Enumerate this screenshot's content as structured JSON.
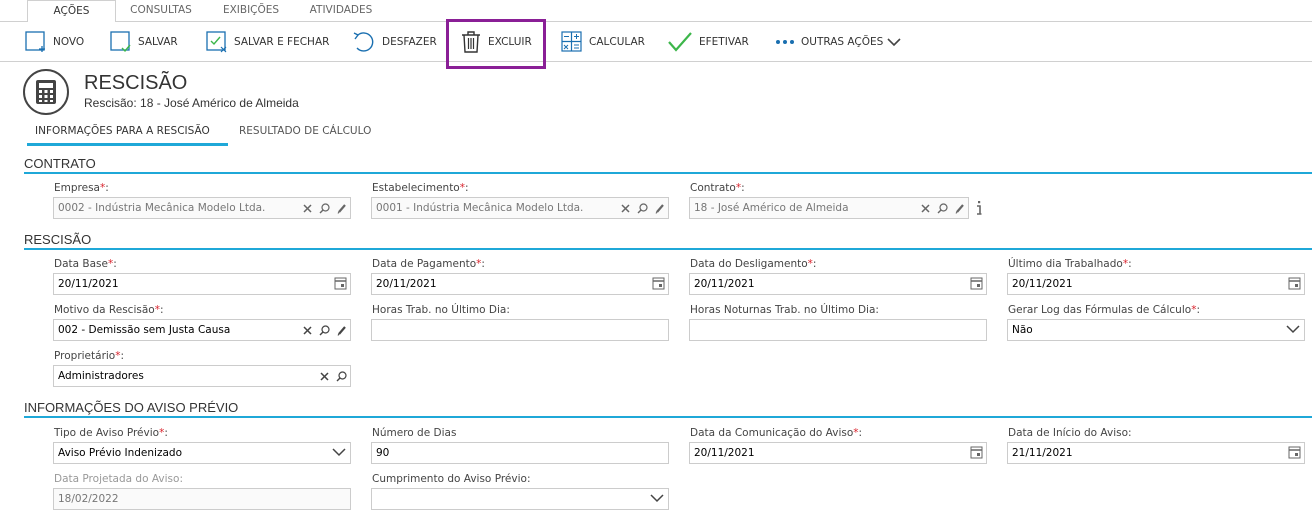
{
  "tabs": [
    "AÇÕES",
    "CONSULTAS",
    "EXIBIÇÕES",
    "ATIVIDADES"
  ],
  "toolbar": {
    "novo": "NOVO",
    "salvar": "SALVAR",
    "salvar_fechar": "SALVAR E FECHAR",
    "desfazer": "DESFAZER",
    "excluir": "EXCLUIR",
    "calcular": "CALCULAR",
    "efetivar": "EFETIVAR",
    "outras": "OUTRAS AÇÕES"
  },
  "header": {
    "title": "RESCISÃO",
    "subtitle": "Rescisão: 18 - José Américo de Almeida"
  },
  "subtabs": [
    "INFORMAÇÕES PARA A RESCISÃO",
    "RESULTADO DE CÁLCULO"
  ],
  "sections": {
    "contrato": "CONTRATO",
    "rescisao": "RESCISÃO",
    "aviso": "INFORMAÇÕES DO AVISO PRÉVIO"
  },
  "fields": {
    "empresa": {
      "label": "Empresa",
      "value": "0002 - Indústria Mecânica Modelo Ltda."
    },
    "estabelecimento": {
      "label": "Estabelecimento",
      "value": "0001 - Indústria Mecânica Modelo Ltda."
    },
    "contrato": {
      "label": "Contrato",
      "value": "18 - José Américo de Almeida"
    },
    "data_base": {
      "label": "Data Base",
      "value": "20/11/2021"
    },
    "data_pagamento": {
      "label": "Data de Pagamento",
      "value": "20/11/2021"
    },
    "data_desligamento": {
      "label": "Data do Desligamento",
      "value": "20/11/2021"
    },
    "ultimo_dia": {
      "label": "Último dia Trabalhado",
      "value": "20/11/2021"
    },
    "motivo": {
      "label": "Motivo da Rescisão",
      "value": "002 - Demissão sem Justa Causa"
    },
    "horas_trab": {
      "label": "Horas Trab. no Último Dia:",
      "value": ""
    },
    "horas_noturnas": {
      "label": "Horas Noturnas Trab. no Último Dia:",
      "value": ""
    },
    "gerar_log": {
      "label": "Gerar Log das Fórmulas de Cálculo",
      "value": "Não"
    },
    "proprietario": {
      "label": "Proprietário",
      "value": "Administradores"
    },
    "tipo_aviso": {
      "label": "Tipo de Aviso Prévio",
      "value": "Aviso Prévio Indenizado"
    },
    "numero_dias": {
      "label": "Número de Dias",
      "value": "90"
    },
    "data_comunicacao": {
      "label": "Data da Comunicação do Aviso",
      "value": "20/11/2021"
    },
    "data_inicio": {
      "label": "Data de Início do Aviso:",
      "value": "21/11/2021"
    },
    "data_projetada": {
      "label": "Data Projetada do Aviso:",
      "value": "18/02/2022"
    },
    "cumprimento": {
      "label": "Cumprimento do Aviso Prévio:",
      "value": ""
    }
  },
  "required_mark": "*",
  "label_suffix": ":",
  "colors": {
    "accent": "#1fa8d8",
    "highlight": "#8a1f96",
    "required": "#d9232d",
    "check": "#3cb64a"
  }
}
